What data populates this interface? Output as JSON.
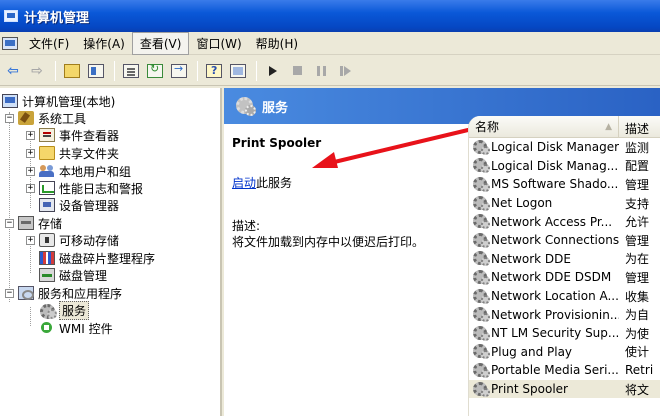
{
  "window": {
    "title": "计算机管理"
  },
  "menu": [
    "文件(F)",
    "操作(A)",
    "查看(V)",
    "窗口(W)",
    "帮助(H)"
  ],
  "tree": {
    "root": "计算机管理(本地)",
    "system_tools": "系统工具",
    "event_viewer": "事件查看器",
    "shared_folders": "共享文件夹",
    "local_users": "本地用户和组",
    "perf_logs": "性能日志和警报",
    "device_manager": "设备管理器",
    "storage": "存储",
    "removable_storage": "可移动存储",
    "disk_defrag": "磁盘碎片整理程序",
    "disk_mgmt": "磁盘管理",
    "services_apps": "服务和应用程序",
    "services": "服务",
    "wmi": "WMI 控件"
  },
  "pane": {
    "header": "服务",
    "service_name": "Print Spooler",
    "start_link": "启动",
    "start_suffix": "此服务",
    "desc_label": "描述:",
    "desc_text": "将文件加载到内存中以便迟后打印。"
  },
  "list": {
    "columns": {
      "name": "名称",
      "desc": "描述"
    },
    "rows": [
      {
        "name": "Logical Disk Manager",
        "desc": "监测"
      },
      {
        "name": "Logical Disk Manag...",
        "desc": "配置"
      },
      {
        "name": "MS Software Shado...",
        "desc": "管理"
      },
      {
        "name": "Net Logon",
        "desc": "支持"
      },
      {
        "name": "Network Access Pr...",
        "desc": "允许"
      },
      {
        "name": "Network Connections",
        "desc": "管理"
      },
      {
        "name": "Network DDE",
        "desc": "为在"
      },
      {
        "name": "Network DDE DSDM",
        "desc": "管理"
      },
      {
        "name": "Network Location A...",
        "desc": "收集"
      },
      {
        "name": "Network Provisionin...",
        "desc": "为自"
      },
      {
        "name": "NT LM Security Sup...",
        "desc": "为使"
      },
      {
        "name": "Plug and Play",
        "desc": "使计"
      },
      {
        "name": "Portable Media Seri...",
        "desc": "Retri"
      },
      {
        "name": "Print Spooler",
        "desc": "将文"
      }
    ]
  },
  "colors": {
    "title_bar": "#0a58d8",
    "header_band": "#2a62c4",
    "annotation_arrow": "#e8121a",
    "link": "#0033cc"
  },
  "icons": {
    "back": "arrow-left-icon",
    "forward": "arrow-right-icon",
    "service": "gear-icon"
  }
}
